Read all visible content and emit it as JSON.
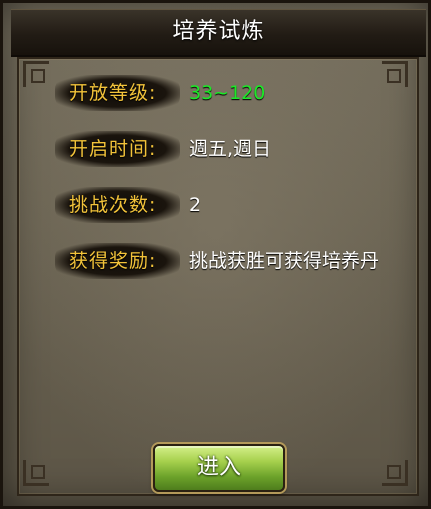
{
  "dialog": {
    "title": "培养试炼",
    "rows": [
      {
        "label": "开放等级:",
        "value": "33~120",
        "value_color": "#1bea27"
      },
      {
        "label": "开启时间:",
        "value": "週五,週日"
      },
      {
        "label": "挑战次数:",
        "value": "2"
      },
      {
        "label": "获得奖励:",
        "value": "挑战获胜可获得培养丹"
      }
    ],
    "enter_button": "进入"
  }
}
